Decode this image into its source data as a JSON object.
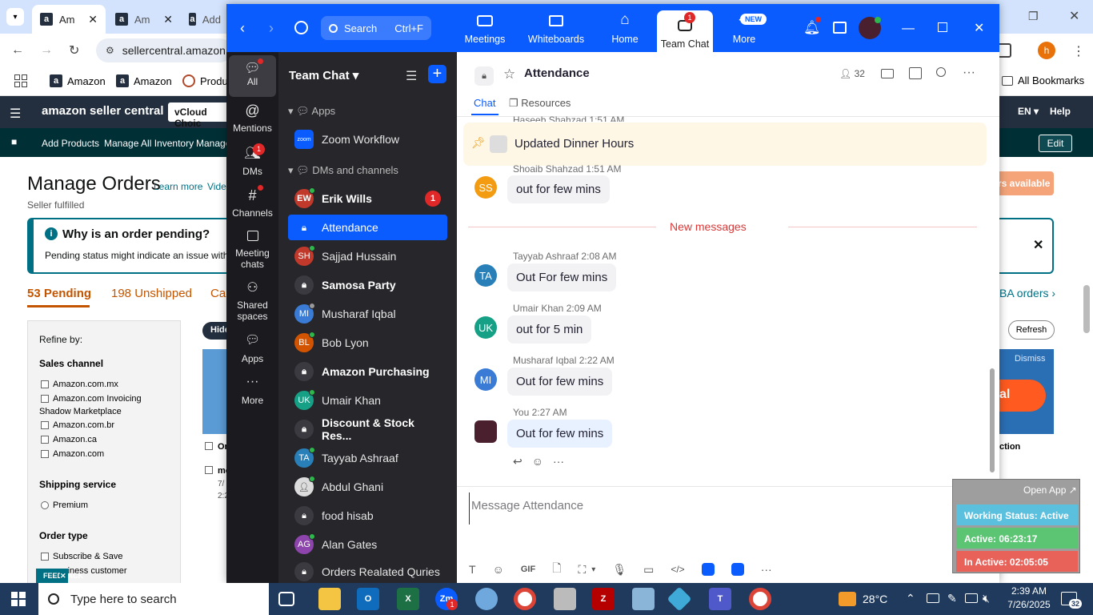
{
  "browser": {
    "tabs": [
      {
        "label": "Am"
      },
      {
        "label": "Am"
      },
      {
        "label": "Add"
      }
    ],
    "address": "sellercentral.amazon",
    "bookmarks": [
      {
        "label": "Amazon"
      },
      {
        "label": "Amazon"
      },
      {
        "label": "Produ"
      }
    ],
    "all_bookmarks": "All Bookmarks",
    "profile_initial": "h"
  },
  "amazon": {
    "logo": "amazon seller central",
    "account": "vCloud Choic",
    "lang": "EN",
    "help": "Help",
    "nav": {
      "add_products": "Add Products",
      "manage_inventory": "Manage All Inventory",
      "manage": "Manage",
      "edit": "Edit"
    },
    "title": "Manage Orders",
    "learn_more": "Learn more",
    "video": "Vide",
    "seller_fulfilled": "Seller fulfilled",
    "why_pending": "Why is an order pending?",
    "pending_desc": "Pending status might indicate an issue with t",
    "tabs": {
      "pending": "53 Pending",
      "unshipped": "198 Unshipped",
      "cancel": "Can",
      "fba": "BA orders"
    },
    "refine_by": "Refine by:",
    "sales_channel": "Sales channel",
    "channels": [
      "Amazon.com.mx",
      "Amazon.com Invoicing",
      "Shadow Marketplace",
      "Amazon.com.br",
      "Amazon.ca",
      "Amazon.com"
    ],
    "shipping_service": "Shipping service",
    "premium": "Premium",
    "order_type": "Order type",
    "subscribe": "Subscribe & Save",
    "business": "usiness customer",
    "hide": "Hide",
    "orders_available": "rs available",
    "refresh": "Refresh",
    "dismiss": "Dismiss",
    "al": "al",
    "action": "ction",
    "feedback": "FEEDBACK",
    "row_a": "Or",
    "row_b": "mo",
    "row_c": "7/",
    "row_d": "2:2"
  },
  "zoom": {
    "nav": {
      "search": "Search",
      "shortcut": "Ctrl+F",
      "meetings": "Meetings",
      "whiteboards": "Whiteboards",
      "home": "Home",
      "team_chat": "Team Chat",
      "team_chat_badge": "1",
      "more": "More",
      "new_badge": "NEW"
    },
    "rail": [
      {
        "label": "All"
      },
      {
        "label": "Mentions"
      },
      {
        "label": "DMs",
        "badge": "1"
      },
      {
        "label": "Channels"
      },
      {
        "label": "Meeting chats"
      },
      {
        "label": "Shared spaces"
      },
      {
        "label": "Apps"
      },
      {
        "label": "More"
      }
    ],
    "list": {
      "title": "Team Chat",
      "sections": {
        "apps": "Apps",
        "dms": "DMs and channels"
      },
      "items": [
        {
          "label": "Zoom Workflow",
          "initials": "zoom",
          "color": "#0b5cff"
        },
        {
          "label": "Erik Wills",
          "initials": "EW",
          "color": "#c0392b",
          "badge": "1"
        },
        {
          "label": "Attendance"
        },
        {
          "label": "Sajjad Hussain",
          "initials": "SH",
          "color": "#c0392b"
        },
        {
          "label": "Samosa Party"
        },
        {
          "label": "Musharaf Iqbal",
          "initials": "MI",
          "color": "#3a7bd5"
        },
        {
          "label": "Bob Lyon",
          "initials": "BL",
          "color": "#d35400"
        },
        {
          "label": "Amazon Purchasing"
        },
        {
          "label": "Umair Khan",
          "initials": "UK",
          "color": "#16a085"
        },
        {
          "label": "Discount & Stock Res..."
        },
        {
          "label": "Tayyab Ashraaf",
          "initials": "TA",
          "color": "#2980b9"
        },
        {
          "label": "Abdul Ghani"
        },
        {
          "label": "food hisab"
        },
        {
          "label": "Alan Gates",
          "initials": "AG",
          "color": "#8e44ad"
        },
        {
          "label": "Orders Realated Quries"
        }
      ]
    },
    "chat": {
      "title": "Attendance",
      "members": "32",
      "tabs": {
        "chat": "Chat",
        "resources": "Resources"
      },
      "pinned": "Updated Dinner Hours",
      "clipped_name": "Haseeb Shahzad 1:51 AM",
      "new_messages": "New messages",
      "messages": [
        {
          "name": "Shoaib Shahzad",
          "time": "1:51 AM",
          "initials": "SS",
          "color": "#f39c12",
          "text": "out for few mins"
        },
        {
          "name": "Tayyab Ashraaf",
          "time": "2:08 AM",
          "initials": "TA",
          "color": "#2980b9",
          "text": "Out For few mins"
        },
        {
          "name": "Umair Khan",
          "time": "2:09 AM",
          "initials": "UK",
          "color": "#16a085",
          "text": "out for 5 min"
        },
        {
          "name": "Musharaf Iqbal",
          "time": "2:22 AM",
          "initials": "MI",
          "color": "#3a7bd5",
          "text": "Out for few mins"
        },
        {
          "name": "You",
          "time": "2:27 AM",
          "initials": "",
          "color": "#4a1f2e",
          "text": "Out for few mins"
        }
      ],
      "input_placeholder": "Message Attendance"
    }
  },
  "widget": {
    "open_app": "Open App",
    "working_status": "Working Status: Active",
    "active": "Active: 06:23:17",
    "inactive": "In Active: 02:05:05"
  },
  "taskbar": {
    "search_placeholder": "Type here to search",
    "weather": "28°C",
    "time": "2:39 AM",
    "date": "7/26/2025",
    "notifications": "32"
  }
}
